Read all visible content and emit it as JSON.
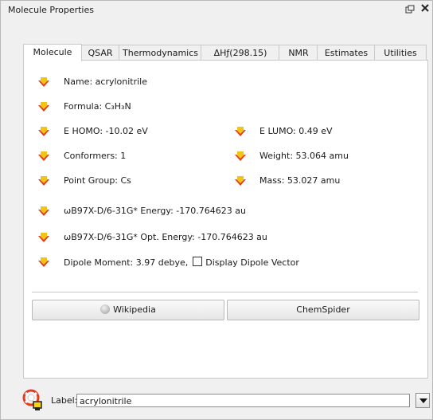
{
  "window": {
    "title": "Molecule Properties"
  },
  "tabs": [
    {
      "label": "Molecule"
    },
    {
      "label": "QSAR"
    },
    {
      "label": "Thermodynamics"
    },
    {
      "label": "ΔHƒ(298.15)"
    },
    {
      "label": "NMR"
    },
    {
      "label": "Estimates"
    },
    {
      "label": "Utilities"
    }
  ],
  "properties": {
    "name": "Name: acrylonitrile",
    "formula": "Formula: C₃H₃N",
    "e_homo": "E HOMO: -10.02 eV",
    "e_lumo": "E LUMO: 0.49 eV",
    "conformers": "Conformers: 1",
    "weight": "Weight: 53.064 amu",
    "point_group": "Point Group: Cs",
    "mass": "Mass: 53.027 amu",
    "energy": "ωB97X-D/6-31G* Energy: -170.764623 au",
    "opt_energy": "ωB97X-D/6-31G* Opt. Energy: -170.764623 au",
    "dipole": "Dipole Moment: 3.97 debye,",
    "dipole_checkbox_label": "Display Dipole Vector",
    "dipole_checkbox_checked": false
  },
  "buttons": {
    "wikipedia": "Wikipedia",
    "chemspider": "ChemSpider"
  },
  "bottom": {
    "label_prefix": "Label:",
    "label_value": "acrylonitrile"
  },
  "icons": {
    "property_icon": "down-arrow-property-icon",
    "colors": {
      "yellow": "#f2c418",
      "red": "#e23b1d"
    }
  }
}
